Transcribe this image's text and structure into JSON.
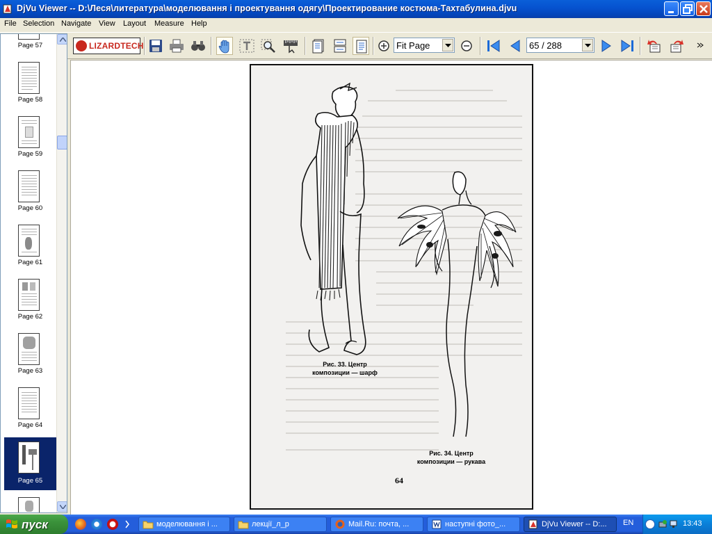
{
  "window": {
    "title": "DjVu Viewer -- D:\\Леся\\литература\\моделювання і проектування одягу\\Проектирование костюма-Тахтабулина.djvu"
  },
  "menu": [
    "File",
    "Selection",
    "Navigate",
    "View",
    "Layout",
    "Measure",
    "Help"
  ],
  "toolbar": {
    "logo_text": "LIZARDTECH",
    "zoom_value": "Fit Page",
    "page_value": "65 / 288"
  },
  "thumbnails": [
    {
      "label": "Page 57",
      "selected": false
    },
    {
      "label": "Page 58",
      "selected": false
    },
    {
      "label": "Page 59",
      "selected": false
    },
    {
      "label": "Page 60",
      "selected": false
    },
    {
      "label": "Page 61",
      "selected": false
    },
    {
      "label": "Page 62",
      "selected": false
    },
    {
      "label": "Page 63",
      "selected": false
    },
    {
      "label": "Page 64",
      "selected": false
    },
    {
      "label": "Page 65",
      "selected": true
    }
  ],
  "document": {
    "caption_left": [
      "Рис. 33. Центр",
      "композиции — шарф"
    ],
    "caption_right": [
      "Рис. 34. Центр",
      "композиции — рукава"
    ],
    "page_number": "64"
  },
  "taskbar": {
    "start_label": "пуск",
    "tasks": [
      {
        "label": "моделювання і ...",
        "icon": "folder-icon",
        "active": false
      },
      {
        "label": "лекції_л_р",
        "icon": "folder-icon",
        "active": false
      },
      {
        "label": "Mail.Ru: почта, ...",
        "icon": "firefox-icon",
        "active": false
      },
      {
        "label": "наступні фото_...",
        "icon": "word-icon",
        "active": false
      },
      {
        "label": "DjVu Viewer -- D:...",
        "icon": "djvu-icon",
        "active": true
      }
    ],
    "language": "EN",
    "clock": "13:43"
  },
  "colors": {
    "titlebar": "#0653d0",
    "taskbar": "#245edb",
    "start_button": "#3a913a",
    "selection": "#0a246a",
    "logo_red": "#c8281e"
  }
}
